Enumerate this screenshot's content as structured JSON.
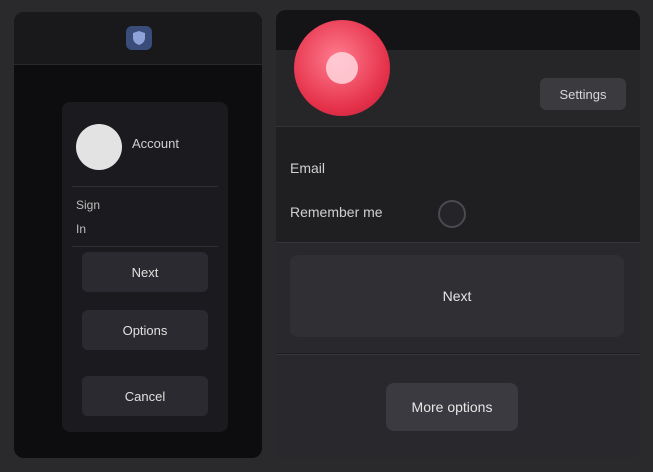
{
  "left_panel": {
    "top_icon": "shield-icon",
    "user_name": "Account",
    "line_1": "Sign",
    "line_2": "In",
    "buttons": [
      "Next",
      "Options",
      "Cancel"
    ]
  },
  "right_panel": {
    "logo_icon": "app-logo-icon",
    "header_button": "Settings",
    "label": "Email",
    "field_label": "Remember me",
    "primary_button": "Next",
    "secondary_button": "More options"
  },
  "colors": {
    "accent": "#e5314a",
    "background": "#2a2a2c"
  }
}
